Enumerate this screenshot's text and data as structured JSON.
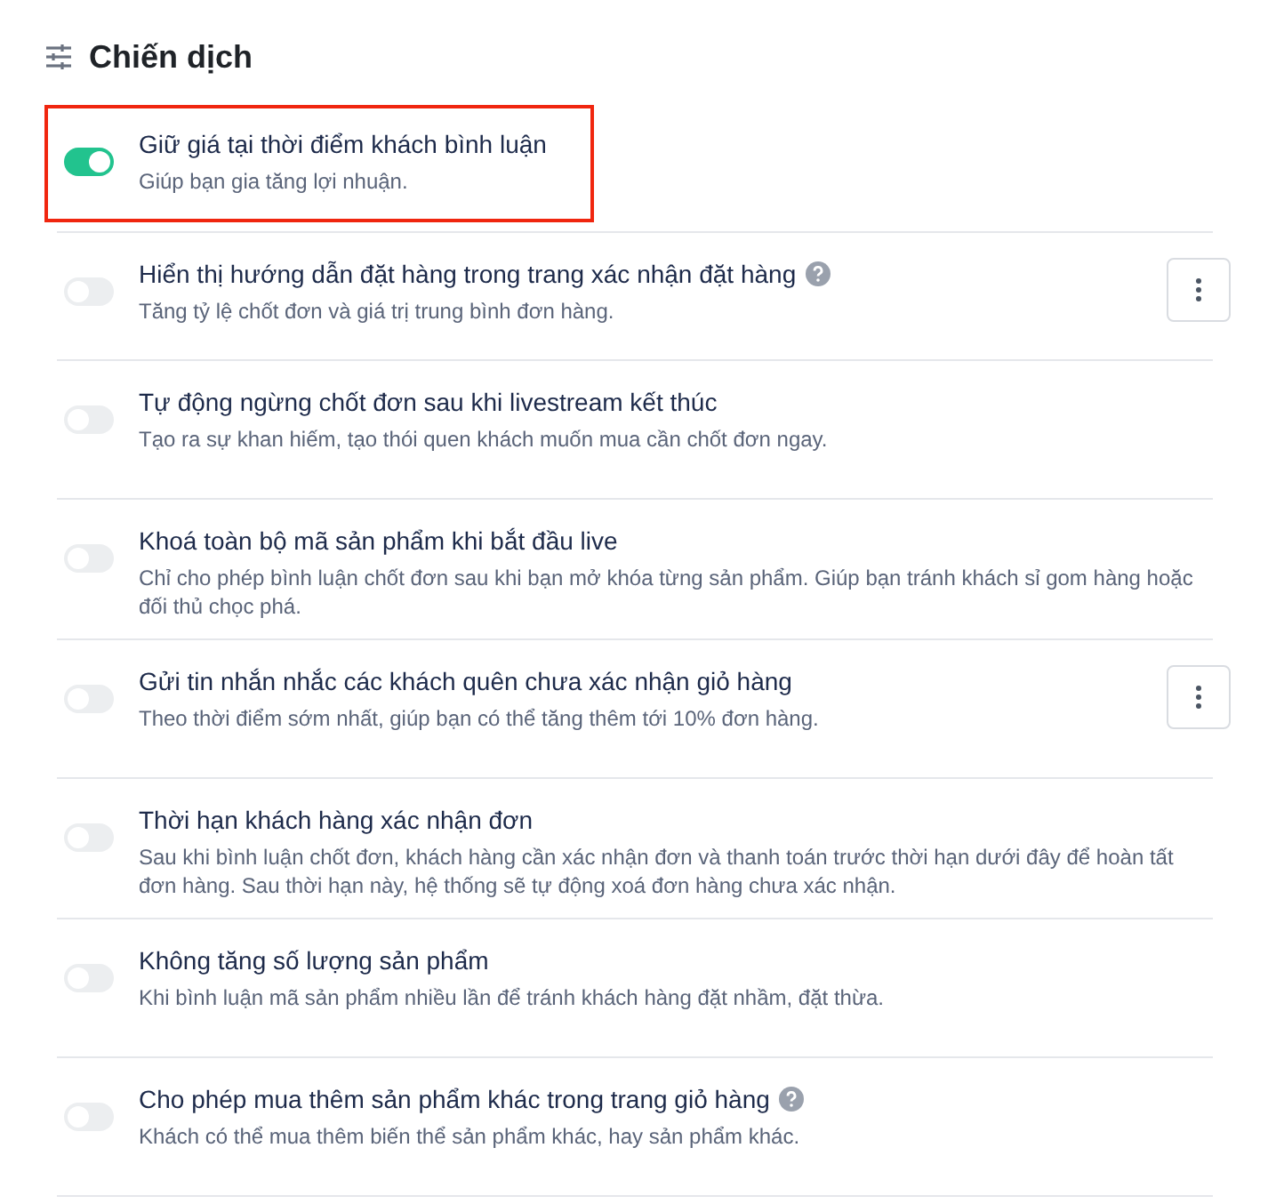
{
  "header": {
    "title": "Chiến dịch"
  },
  "settings": [
    {
      "title": "Giữ giá tại thời điểm khách bình luận",
      "description": "Giúp bạn gia tăng lợi nhuận.",
      "on": true,
      "highlighted": true,
      "help": false,
      "menu": false
    },
    {
      "title": "Hiển thị hướng dẫn đặt hàng trong trang xác nhận đặt hàng",
      "description": "Tăng tỷ lệ chốt đơn và giá trị trung bình đơn hàng.",
      "on": false,
      "highlighted": false,
      "help": true,
      "menu": true
    },
    {
      "title": "Tự động ngừng chốt đơn sau khi livestream kết thúc",
      "description": "Tạo ra sự khan hiếm, tạo thói quen khách muốn mua cần chốt đơn ngay.",
      "on": false,
      "highlighted": false,
      "help": false,
      "menu": false
    },
    {
      "title": "Khoá toàn bộ mã sản phẩm khi bắt đầu live",
      "description": "Chỉ cho phép bình luận chốt đơn sau khi bạn mở khóa từng sản phẩm. Giúp bạn tránh khách sỉ gom hàng hoặc đối thủ chọc phá.",
      "on": false,
      "highlighted": false,
      "help": false,
      "menu": false
    },
    {
      "title": "Gửi tin nhắn nhắc các khách quên chưa xác nhận giỏ hàng",
      "description": "Theo thời điểm sớm nhất, giúp bạn có thể tăng thêm tới 10% đơn hàng.",
      "on": false,
      "highlighted": false,
      "help": false,
      "menu": true
    },
    {
      "title": "Thời hạn khách hàng xác nhận đơn",
      "description": "Sau khi bình luận chốt đơn, khách hàng cần xác nhận đơn và thanh toán trước thời hạn dưới đây để hoàn tất đơn hàng. Sau thời hạn này, hệ thống sẽ tự động xoá đơn hàng chưa xác nhận.",
      "on": false,
      "highlighted": false,
      "help": false,
      "menu": false
    },
    {
      "title": "Không tăng số lượng sản phẩm",
      "description": "Khi bình luận mã sản phẩm nhiều lần để tránh khách hàng đặt nhầm, đặt thừa.",
      "on": false,
      "highlighted": false,
      "help": false,
      "menu": false
    },
    {
      "title": "Cho phép mua thêm sản phẩm khác trong trang giỏ hàng",
      "description": "Khách có thể mua thêm biến thể sản phẩm khác, hay sản phẩm khác.",
      "on": false,
      "highlighted": false,
      "help": true,
      "menu": false
    }
  ]
}
